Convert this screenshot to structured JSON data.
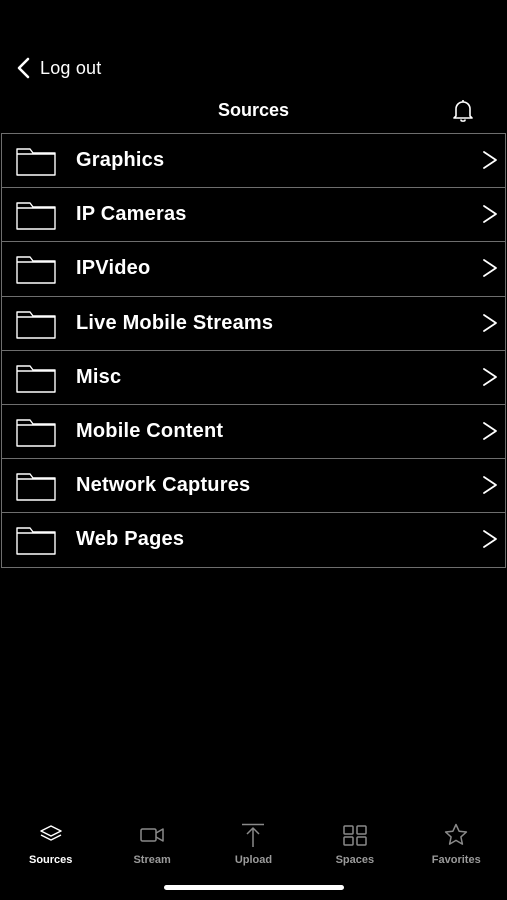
{
  "header": {
    "back_label": "Log out",
    "title": "Sources"
  },
  "sources": [
    {
      "label": "Graphics"
    },
    {
      "label": "IP Cameras"
    },
    {
      "label": "IPVideo"
    },
    {
      "label": "Live Mobile Streams"
    },
    {
      "label": "Misc"
    },
    {
      "label": "Mobile Content"
    },
    {
      "label": "Network Captures"
    },
    {
      "label": "Web Pages"
    }
  ],
  "tabs": [
    {
      "label": "Sources",
      "icon": "layers-icon",
      "active": true
    },
    {
      "label": "Stream",
      "icon": "video-camera-icon",
      "active": false
    },
    {
      "label": "Upload",
      "icon": "upload-icon",
      "active": false
    },
    {
      "label": "Spaces",
      "icon": "grid-icon",
      "active": false
    },
    {
      "label": "Favorites",
      "icon": "star-icon",
      "active": false
    }
  ],
  "colors": {
    "background": "#000000",
    "text": "#ffffff",
    "inactive_tab": "#9a9a9a",
    "row_border": "#6e6e6e"
  }
}
